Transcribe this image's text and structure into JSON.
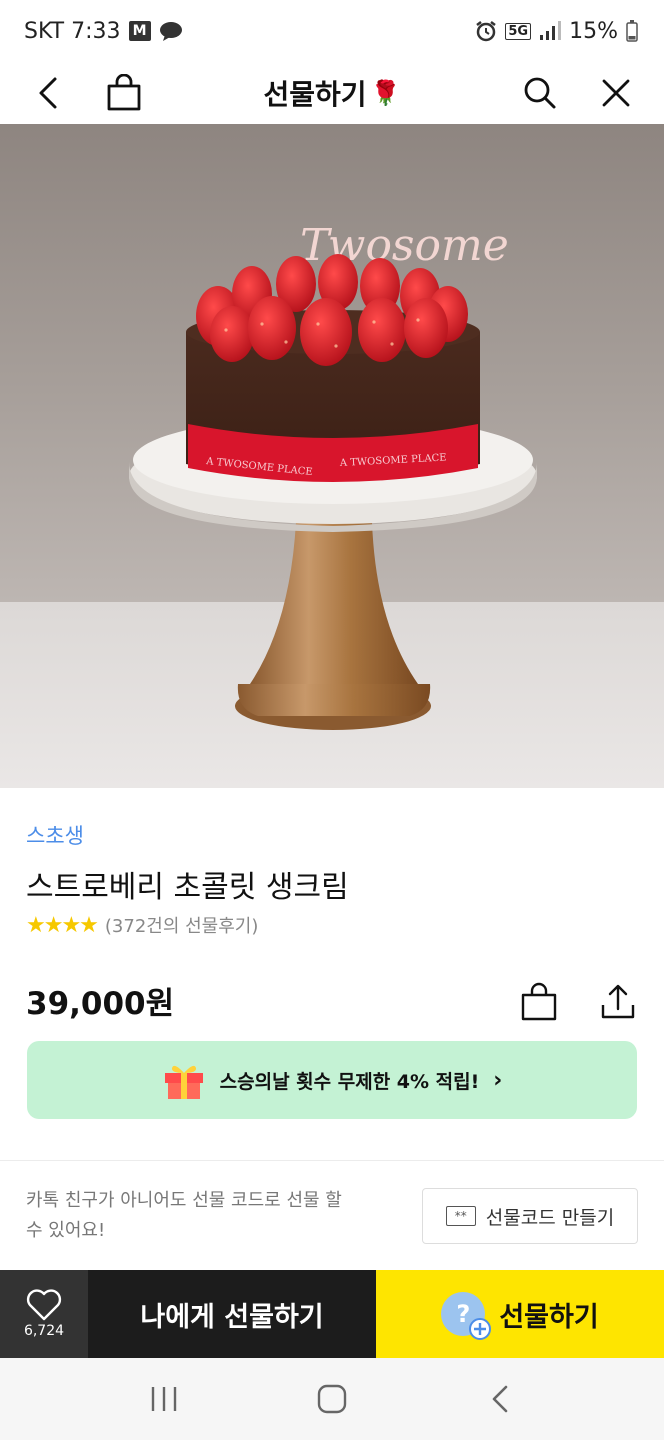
{
  "status_bar": {
    "carrier_time": "SKT 7:33",
    "mail_badge": "M",
    "network": "5G",
    "battery": "15%"
  },
  "nav": {
    "title": "선물하기",
    "title_emoji": "🌹"
  },
  "hero": {
    "topper_text": "Twosome",
    "ribbon_text_1": "A TWOSOME PLACE",
    "ribbon_text_2": "A TWOSOME PLACE"
  },
  "product": {
    "brand": "스초생",
    "name": "스트로베리 초콜릿 생크림",
    "stars": "★★★★",
    "review_text": "(372건의 선물후기)",
    "price": "39,000원"
  },
  "promo": {
    "text": "스승의날 횟수 무제한 4% 적립!",
    "chevron": "›"
  },
  "gift_code": {
    "description": "카톡 친구가 아니어도 선물 코드로 선물 할 수 있어요!",
    "button_icon_text": "**",
    "button_label": "선물코드 만들기"
  },
  "bottom_bar": {
    "like_count": "6,724",
    "self_gift_label": "나에게 선물하기",
    "gift_label": "선물하기",
    "gift_icon_text": "?"
  },
  "colors": {
    "brand_blue": "#4c8de8",
    "kakao_yellow": "#fee500",
    "promo_green": "#c4f2d4",
    "star_yellow": "#f6c800",
    "dark_bar": "#1c1c1c"
  },
  "icons": [
    "back-arrow-icon",
    "shopping-bag-icon",
    "search-icon",
    "close-icon",
    "heart-icon",
    "share-icon",
    "gift-box-icon",
    "ticket-icon",
    "recent-apps-icon",
    "home-icon"
  ]
}
